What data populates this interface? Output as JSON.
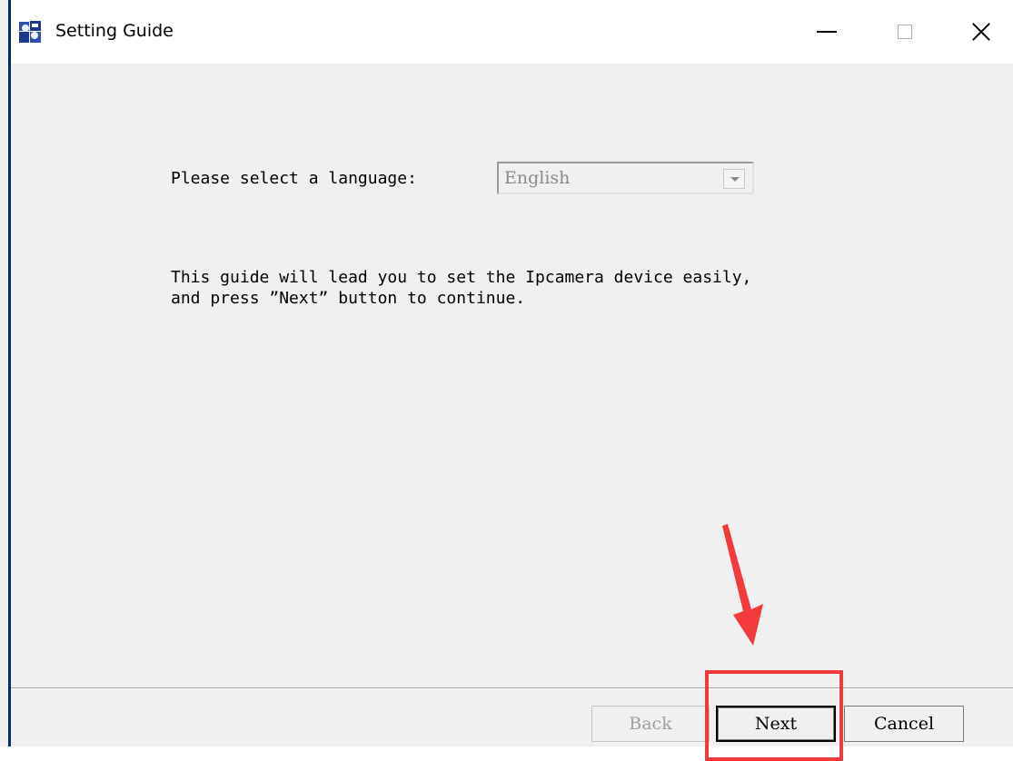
{
  "window": {
    "title": "Setting Guide",
    "icon": "setting-guide-app-icon",
    "controls": {
      "minimize": "minimize-icon",
      "maximize": "maximize-icon",
      "close": "close-icon"
    }
  },
  "language": {
    "label": "Please select a language:",
    "selected": "English"
  },
  "guide": {
    "line1": "This guide will lead you to set the Ipcamera device easily,",
    "line2": "and press ”Next” button to continue."
  },
  "buttons": {
    "back": "Back",
    "next": "Next",
    "cancel": "Cancel"
  },
  "annotation": {
    "color": "#f23a3a"
  }
}
